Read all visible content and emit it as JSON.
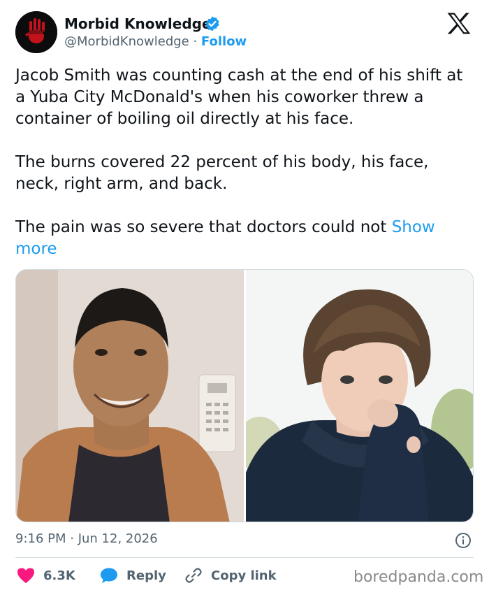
{
  "author": {
    "name": "Morbid Knowledge",
    "handle": "@MorbidKnowledge",
    "separator": " · ",
    "follow_label": "Follow"
  },
  "tweet": {
    "paragraphs": [
      "Jacob Smith was counting cash at the end of his shift at a Yuba City McDonald's when his coworker threw a container of boiling oil directly at his face.",
      "The burns covered 22 percent of his body, his face, neck, right arm, and back."
    ],
    "last_paragraph": "The pain was so severe that doctors could not ",
    "show_more_label": "Show more"
  },
  "meta": {
    "timestamp": "9:16 PM · Jun 12, 2026"
  },
  "actions": {
    "likes_count": "6.3K",
    "reply_label": "Reply",
    "copy_link_label": "Copy link"
  },
  "watermark": "boredpanda.com",
  "colors": {
    "accent": "#1d9bf0",
    "like": "#f91880",
    "text": "#0f1419",
    "muted": "#536471",
    "border": "#cfd9de"
  },
  "icons": [
    "verified-badge-icon",
    "x-logo-icon",
    "info-icon",
    "heart-icon",
    "reply-bubble-icon",
    "link-icon"
  ]
}
